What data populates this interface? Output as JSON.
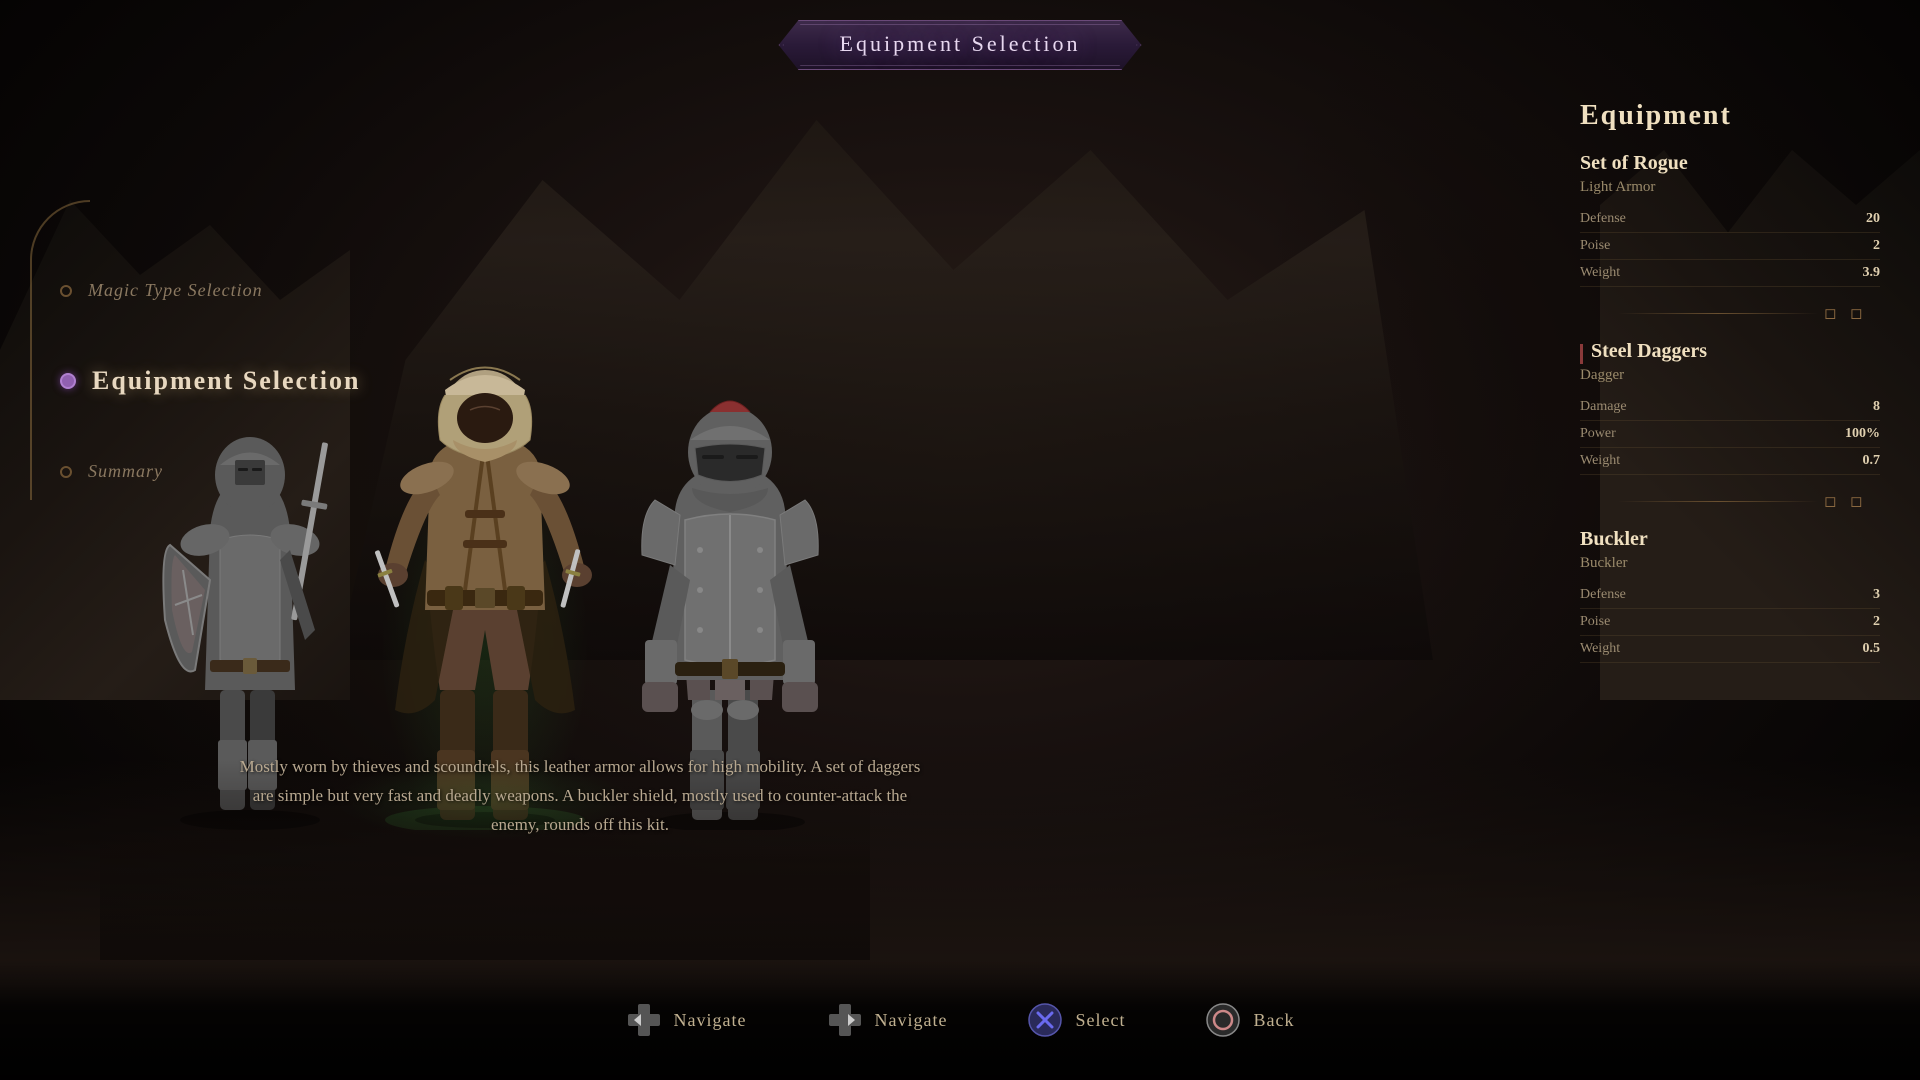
{
  "title": {
    "label": "Equipment Selection"
  },
  "nav": {
    "items": [
      {
        "id": "magic-type",
        "label": "Magic Type Selection",
        "active": false
      },
      {
        "id": "equipment",
        "label": "Equipment Selection",
        "active": true
      },
      {
        "id": "summary",
        "label": "Summary",
        "active": false
      }
    ]
  },
  "equipment_panel": {
    "title": "Equipment",
    "sections": [
      {
        "id": "armor",
        "name": "Set of Rogue",
        "type": "Light Armor",
        "stats": [
          {
            "label": "Defense",
            "value": "20"
          },
          {
            "label": "Poise",
            "value": "2"
          },
          {
            "label": "Weight",
            "value": "3.9"
          }
        ]
      },
      {
        "id": "weapon",
        "name": "Steel Daggers",
        "type": "Dagger",
        "stats": [
          {
            "label": "Damage",
            "value": "8"
          },
          {
            "label": "Power",
            "value": "100%"
          },
          {
            "label": "Weight",
            "value": "0.7"
          }
        ]
      },
      {
        "id": "shield",
        "name": "Buckler",
        "type": "Buckler",
        "stats": [
          {
            "label": "Defense",
            "value": "3"
          },
          {
            "label": "Poise",
            "value": "2"
          },
          {
            "label": "Weight",
            "value": "0.5"
          }
        ]
      }
    ]
  },
  "description": {
    "text": "Mostly worn by thieves and scoundrels, this leather armor allows for high mobility. A set of daggers\nare simple but very fast and deadly weapons. A buckler shield, mostly used to counter-attack the\nenemy, rounds off this kit."
  },
  "bottom_bar": {
    "actions": [
      {
        "id": "navigate-left",
        "icon": "✛",
        "label": "Navigate",
        "type": "dpad"
      },
      {
        "id": "navigate-right",
        "icon": "✛",
        "label": "Navigate",
        "type": "dpad"
      },
      {
        "id": "select",
        "icon": "✕",
        "label": "Select",
        "type": "cross"
      },
      {
        "id": "back",
        "icon": "○",
        "label": "Back",
        "type": "circle"
      }
    ]
  },
  "colors": {
    "accent": "#9060b0",
    "gold": "#8a6840",
    "text_primary": "#f0e0c0",
    "text_secondary": "#9a8a6a",
    "bg_dark": "#0d0908"
  }
}
